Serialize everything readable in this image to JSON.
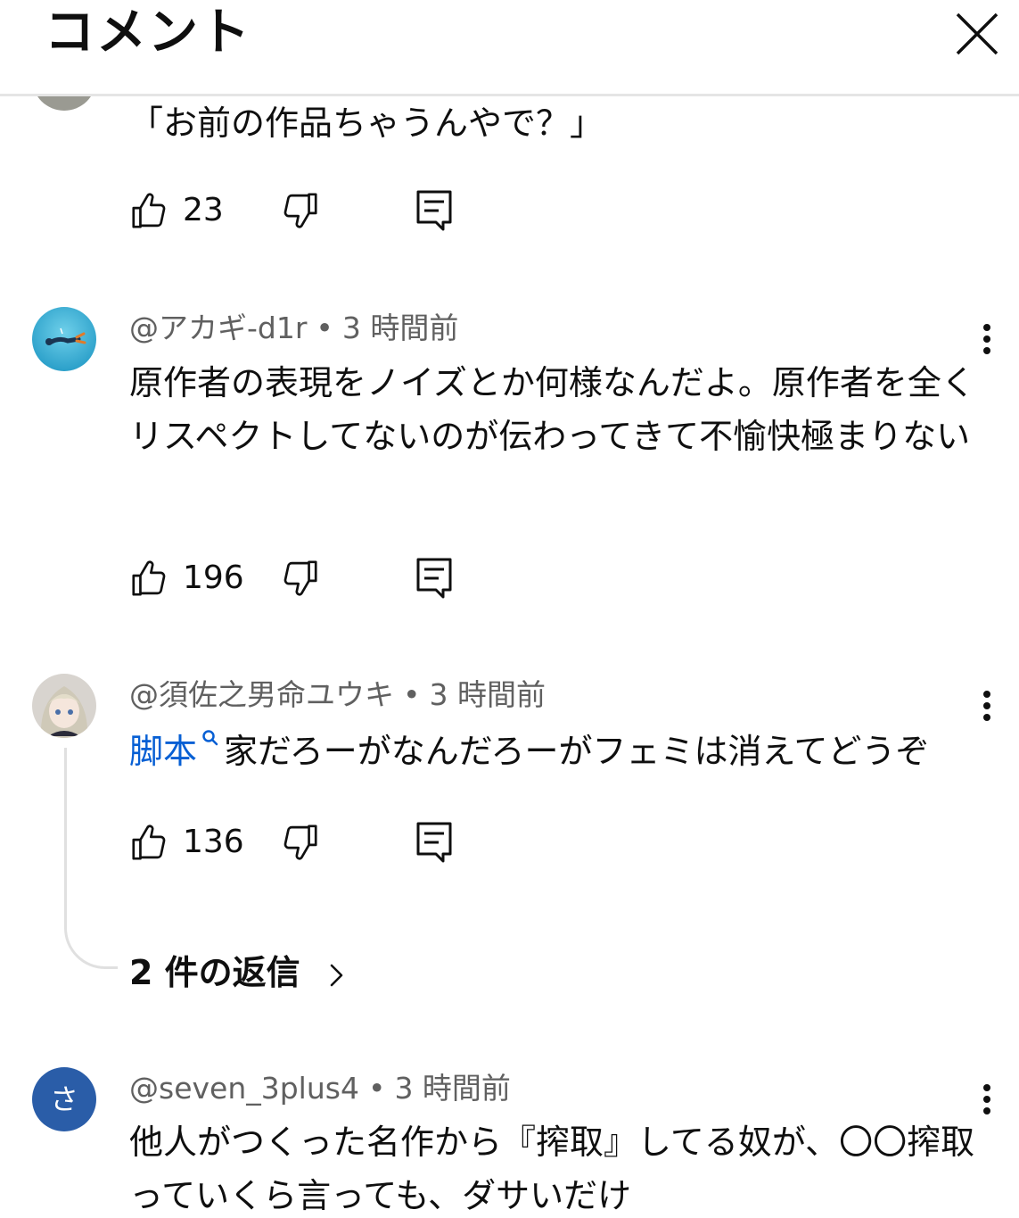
{
  "header": {
    "title": "コメント"
  },
  "comments": [
    {
      "text": "「お前の作品ちゃうんやで？」",
      "likes": "23"
    },
    {
      "author": "@アカギ-d1r",
      "time": "3 時間前",
      "text": "原作者の表現をノイズとか何様なんだよ。原作者を全くリスペクトしてないのが伝わってきて不愉快極まりない",
      "likes": "196"
    },
    {
      "author": "@須佐之男命ユウキ",
      "time": "3 時間前",
      "link_text": "脚本",
      "text": "家だろーがなんだろーがフェミは消えてどうぞ",
      "likes": "136",
      "replies_label": "2 件の返信"
    },
    {
      "author": "@seven_3plus4",
      "time": "3 時間前",
      "avatar_letter": "さ",
      "text": "他人がつくった名作から『搾取』してる奴が、〇〇搾取っていくら言っても、ダサいだけ"
    }
  ],
  "colors": {
    "link": "#065fd4",
    "meta": "#606060",
    "avatar_seven": "#2a5da8"
  }
}
